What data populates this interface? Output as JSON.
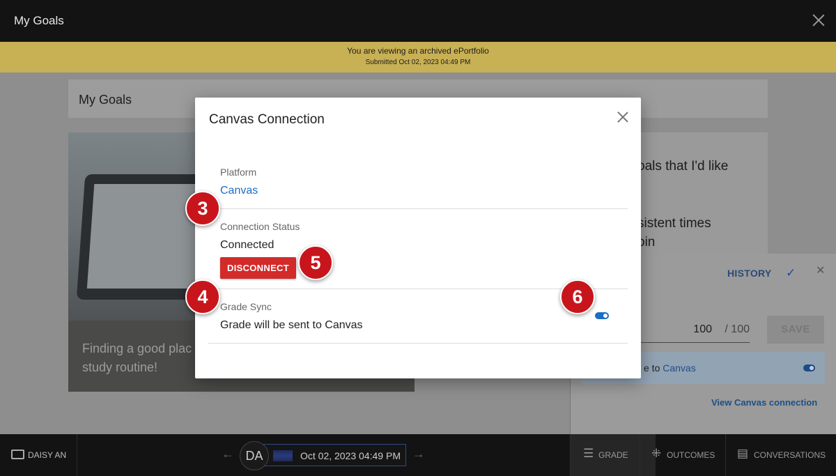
{
  "topbar": {
    "title": "My Goals"
  },
  "banner": {
    "line1": "You are viewing an archived ePortfolio",
    "line2": "Submitted Oct 02, 2023 04:49 PM"
  },
  "background": {
    "header_title": "My Goals",
    "card_caption_line1": "Finding a good plac",
    "card_caption_line2": "study routine!",
    "text_line1": "oals that I'd like",
    "text_line2": "sistent times",
    "text_line3": "oin"
  },
  "grade_panel": {
    "history_label": "HISTORY",
    "score_value": "100",
    "score_max": "/ 100",
    "save_label": "SAVE",
    "sync_text_prefix": "e to ",
    "sync_text_link": "Canvas",
    "view_connection_label": "View Canvas connection",
    "sync_enabled": true
  },
  "modal": {
    "title": "Canvas Connection",
    "platform_label": "Platform",
    "platform_value": "Canvas",
    "status_label": "Connection Status",
    "status_value": "Connected",
    "disconnect_label": "DISCONNECT",
    "grade_sync_label": "Grade Sync",
    "grade_sync_value": "Grade will be sent to Canvas",
    "grade_sync_enabled": true,
    "accent_color": "#1c6ec4",
    "danger_color": "#d32a2a"
  },
  "markers": {
    "m3": "3",
    "m4": "4",
    "m5": "5",
    "m6": "6"
  },
  "bottombar": {
    "user_label": "DAISY AN",
    "avatar_initials": "DA",
    "date_label": "Oct 02, 2023 04:49 PM",
    "tabs": [
      {
        "label": "GRADE",
        "icon": "grade-icon"
      },
      {
        "label": "OUTCOMES",
        "icon": "outcomes-icon"
      },
      {
        "label": "CONVERSATIONS",
        "icon": "conversations-icon"
      }
    ]
  }
}
